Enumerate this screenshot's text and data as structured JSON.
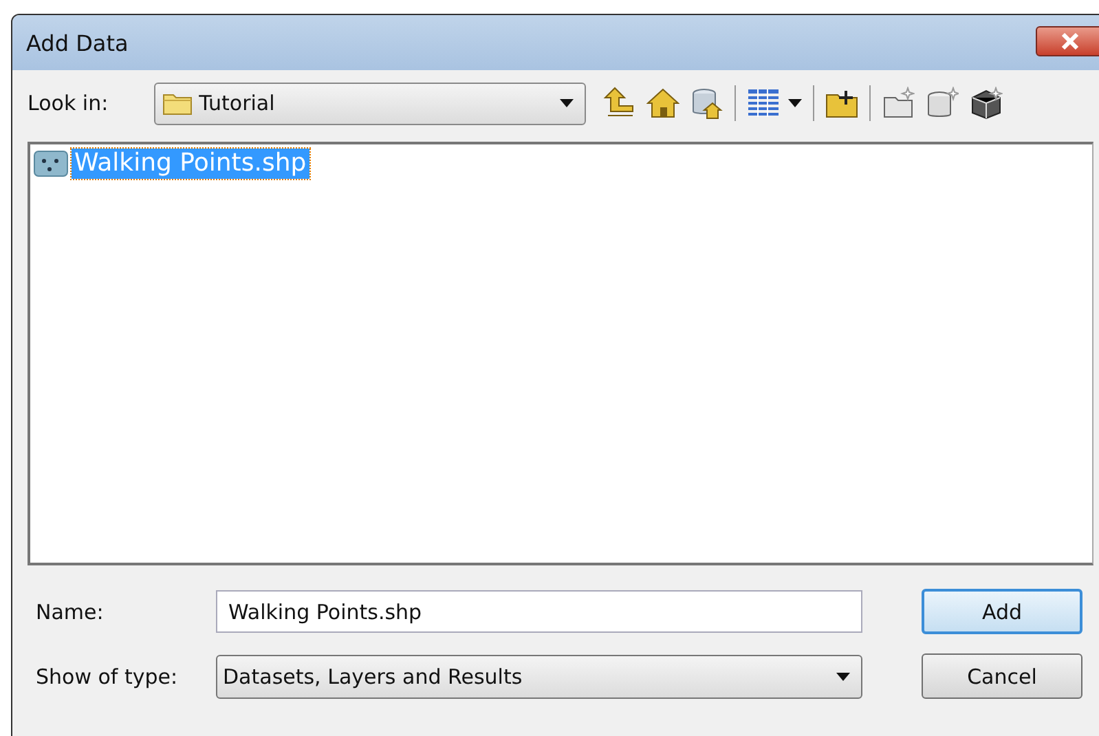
{
  "window": {
    "title": "Add Data"
  },
  "look_in": {
    "label": "Look in:",
    "value": "Tutorial"
  },
  "files": [
    {
      "name": "Walking Points.shp",
      "selected": true
    }
  ],
  "name_field": {
    "label": "Name:",
    "value": "Walking Points.shp"
  },
  "type_field": {
    "label": "Show of type:",
    "value": "Datasets, Layers and Results"
  },
  "buttons": [
    {
      "label": "Add",
      "default": true
    },
    {
      "label": "Cancel",
      "default": false
    }
  ]
}
